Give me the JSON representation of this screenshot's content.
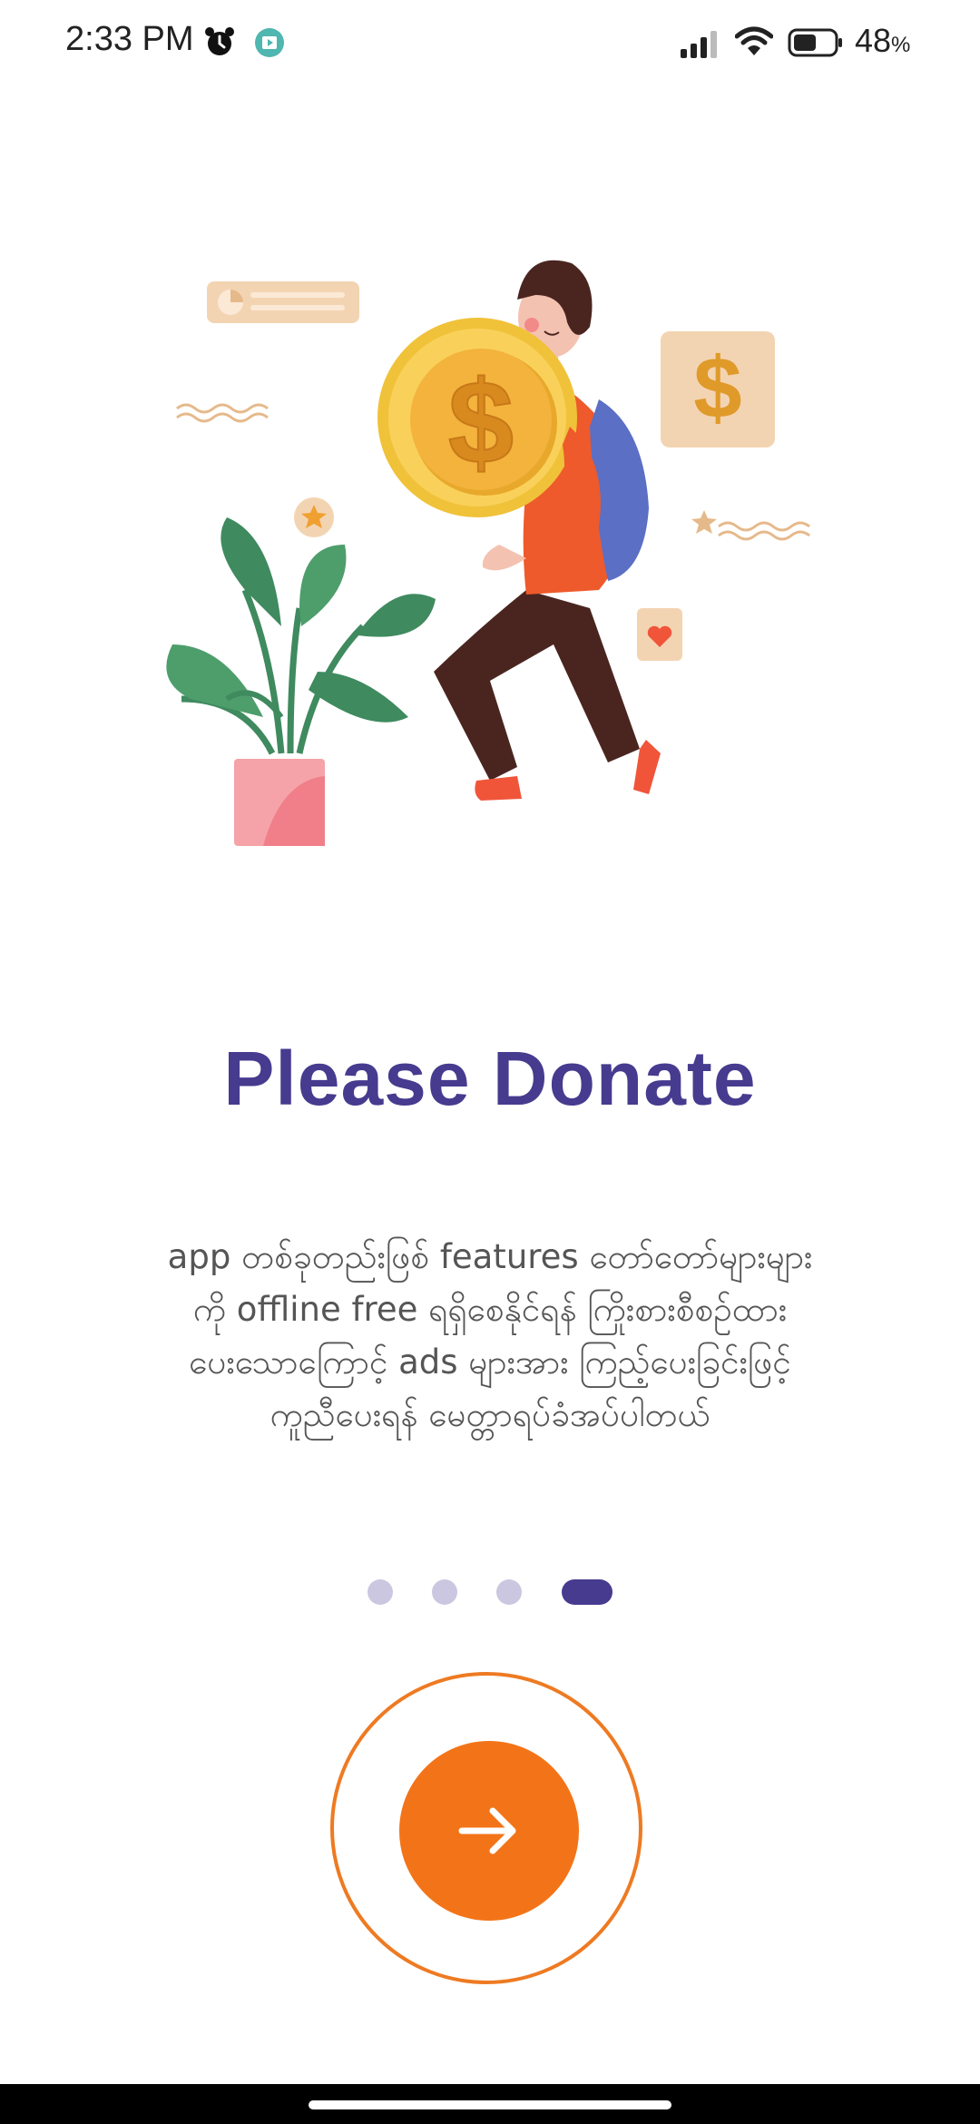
{
  "status_bar": {
    "time": "2:33 PM",
    "battery_percent": "48",
    "battery_unit": "%",
    "icons": [
      "alarm-icon",
      "media-icon",
      "signal-icon",
      "wifi-icon",
      "battery-icon"
    ]
  },
  "onboarding": {
    "title": "Please Donate",
    "description_lines": [
      "app တစ်ခုတည်းဖြစ် features တော်တော်များများ",
      "ကို offline free ရရှိစေနိုင်ရန် ကြိုးစားစီစဉ်ထား",
      "ပေးသောကြောင့် ads များအား ကြည့်ပေးခြင်းဖြင့်",
      "ကူညီပေးရန် မေတ္တာရပ်ခံအပ်ပါတယ်"
    ],
    "page_indicator": {
      "total": 4,
      "current": 4
    },
    "next_button_icon": "arrow-right-icon"
  },
  "colors": {
    "title": "#463b8e",
    "accent": "#f37418",
    "dot_inactive": "#cbc7e0",
    "dot_active": "#463b8e"
  }
}
